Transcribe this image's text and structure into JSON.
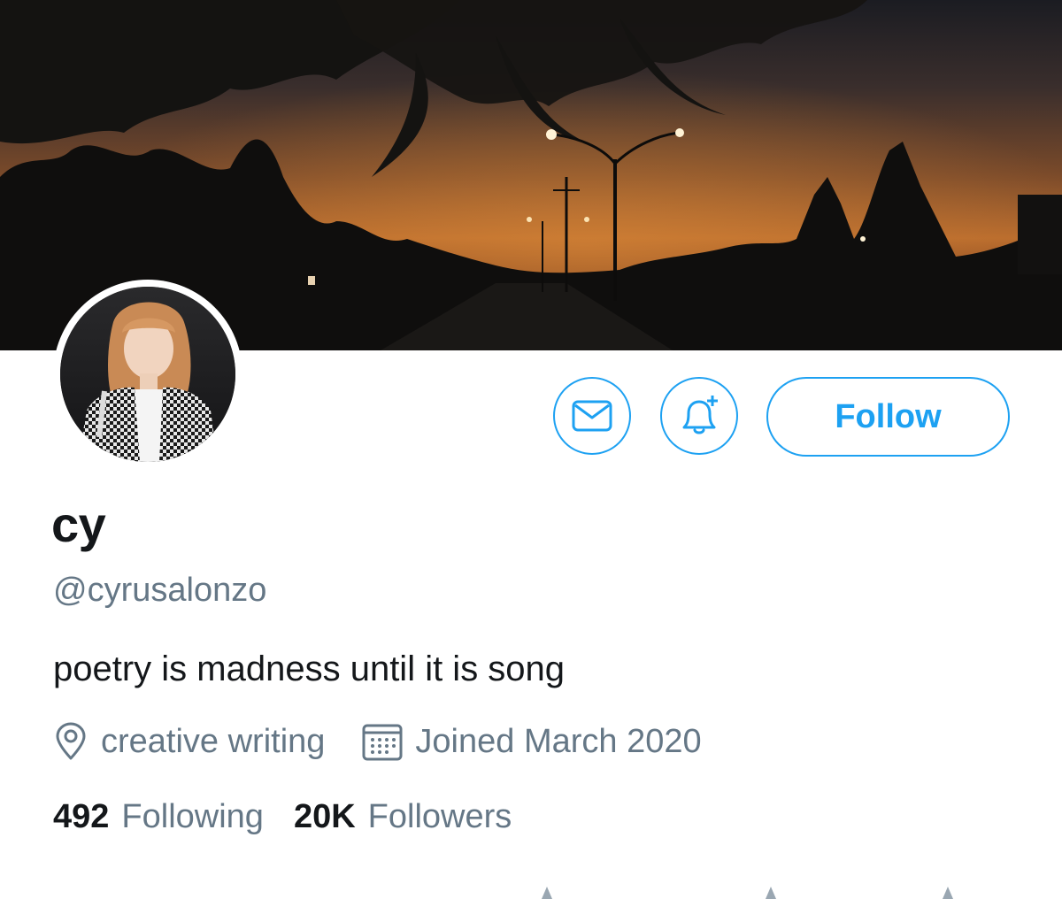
{
  "profile": {
    "display_name": "cy",
    "handle": "@cyrusalonzo",
    "bio": "poetry is madness until it is song",
    "location": "creative writing",
    "joined": "Joined March 2020"
  },
  "actions": {
    "follow_label": "Follow",
    "message_icon": "envelope-icon",
    "notify_icon": "bell-plus-icon"
  },
  "stats": {
    "following_count": "492",
    "following_label": "Following",
    "followers_count": "20K",
    "followers_label": "Followers"
  },
  "colors": {
    "accent": "#1da1f2",
    "secondary_text": "#657786",
    "primary_text": "#14171a"
  }
}
